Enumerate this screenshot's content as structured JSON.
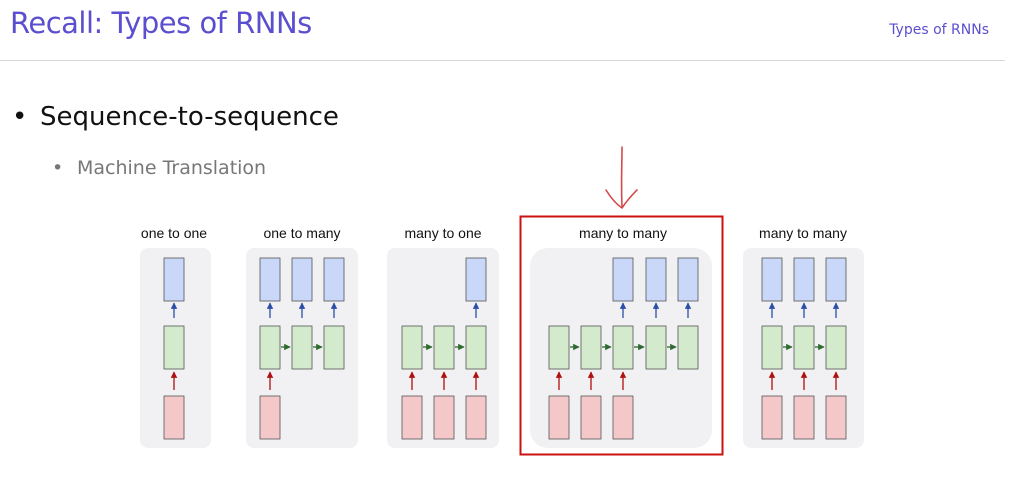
{
  "slide": {
    "title": "Recall: Types of RNNs",
    "section_label": "Types of RNNs",
    "bullet_marker": "•",
    "bullet_main": "Sequence-to-sequence",
    "bullet_sub": "Machine Translation"
  },
  "diagrams": [
    {
      "title": "one to one"
    },
    {
      "title": "one to many"
    },
    {
      "title": "many to one"
    },
    {
      "title": "many to many",
      "highlighted": true
    },
    {
      "title": "many to many"
    }
  ],
  "colors": {
    "accent": "#5b4fcf",
    "input_box": "#f4c7c9",
    "hidden_box": "#d3ebcc",
    "output_box": "#c9d8f8",
    "input_arrow": "#b01010",
    "hidden_arrow": "#2f6b2f",
    "output_arrow": "#2b4fa8",
    "highlight": "#cc1111"
  }
}
